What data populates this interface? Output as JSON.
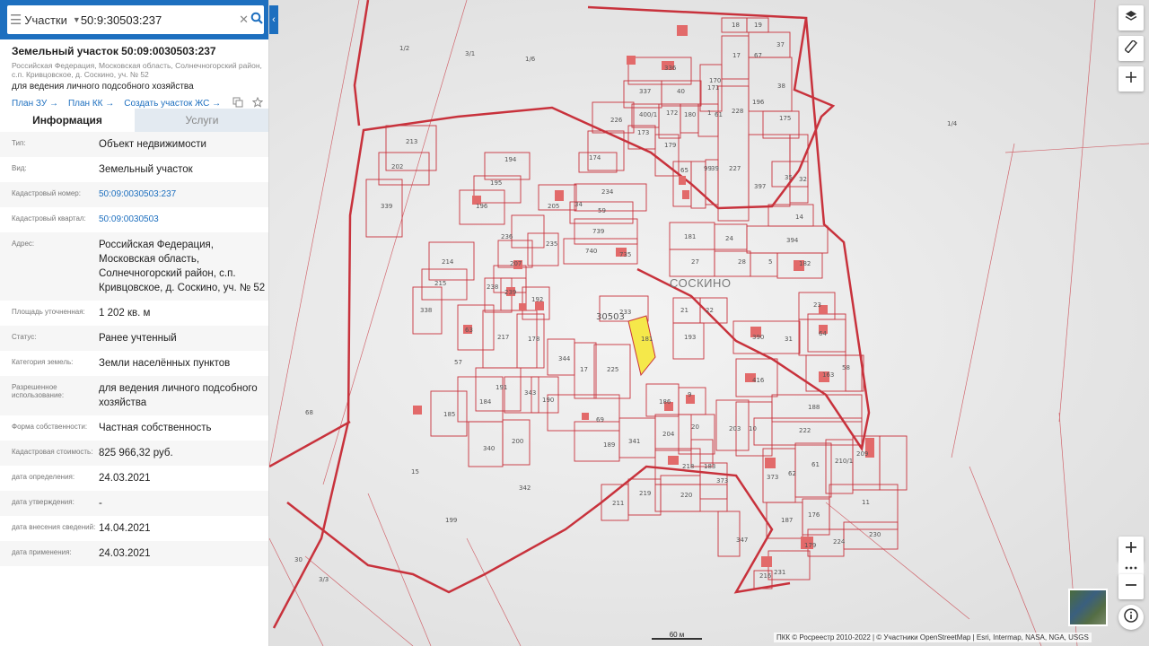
{
  "search": {
    "menu_icon": "hamburger-icon",
    "type_label": "Участки",
    "query": "50:9:30503:237",
    "clear_icon": "close-icon",
    "search_icon": "search-icon",
    "collapse_icon": "chevron-left-icon"
  },
  "object": {
    "title": "Земельный участок 50:09:0030503:237",
    "address_short": "Российская Федерация, Московская область, Солнечногорский район, с.п. Кривцовское, д. Соскино, уч. № 52",
    "purpose": "для ведения личного подсобного хозяйства",
    "links": [
      "План ЗУ →",
      "План КК →",
      "Создать участок ЖС →"
    ]
  },
  "tabs": [
    "Информация",
    "Услуги"
  ],
  "info_rows": [
    {
      "label": "Тип:",
      "value": "Объект недвижимости"
    },
    {
      "label": "Вид:",
      "value": "Земельный участок"
    },
    {
      "label": "Кадастровый номер:",
      "value": "50:09:0030503:237"
    },
    {
      "label": "Кадастровый квартал:",
      "value": "50:09:0030503"
    },
    {
      "label": "Адрес:",
      "value": "Российская Федерация, Московская область, Солнечногорский район, с.п. Кривцовское, д. Соскино, уч. № 52"
    },
    {
      "label": "Площадь уточненная:",
      "value": "1 202 кв. м"
    },
    {
      "label": "Статус:",
      "value": "Ранее учтенный"
    },
    {
      "label": "Категория земель:",
      "value": "Земли населённых пунктов"
    },
    {
      "label": "Разрешенное использование:",
      "value": "для ведения личного подсобного хозяйства"
    },
    {
      "label": "Форма собственности:",
      "value": "Частная собственность"
    },
    {
      "label": "Кадастровая стоимость:",
      "value": "825 966,32 руб."
    },
    {
      "label": "дата определения:",
      "value": "24.03.2021"
    },
    {
      "label": "дата утверждения:",
      "value": "-"
    },
    {
      "label": "дата внесения сведений:",
      "value": "14.04.2021"
    },
    {
      "label": "дата применения:",
      "value": "24.03.2021"
    }
  ],
  "map": {
    "village_label": "СОСКИНО",
    "quarter_label": "30503",
    "scale_label": "60 м",
    "attribution": "ПКК © Росреестр 2010-2022 | © Участники OpenStreetMap | Esri, Intermap, NASA, NGA, USGS",
    "parcel_labels": [
      "1/2",
      "1/6",
      "1/4",
      "3/1",
      "3/3",
      "30",
      "18",
      "19",
      "37",
      "17",
      "67",
      "38",
      "336",
      "337",
      "40",
      "171",
      "170",
      "228",
      "196",
      "226",
      "400/1",
      "172",
      "180",
      "1",
      "61",
      "175",
      "173",
      "174",
      "179",
      "65",
      "99",
      "39",
      "227",
      "397",
      "35",
      "32",
      "213",
      "202",
      "339",
      "194",
      "195",
      "196",
      "205",
      "234",
      "34",
      "59",
      "14",
      "739",
      "740",
      "735",
      "181",
      "24",
      "394",
      "27",
      "28",
      "5",
      "182",
      "214",
      "215",
      "338",
      "236",
      "235",
      "207",
      "238",
      "239",
      "192",
      "233",
      "21",
      "22",
      "23",
      "64",
      "63",
      "217",
      "178",
      "193",
      "390",
      "31",
      "57",
      "344",
      "17",
      "225",
      "416",
      "163",
      "58",
      "191",
      "343",
      "190",
      "185",
      "184",
      "69",
      "186",
      "9",
      "188",
      "68",
      "340",
      "200",
      "189",
      "341",
      "204",
      "20",
      "203",
      "10",
      "222",
      "15",
      "342",
      "218",
      "183",
      "373",
      "373",
      "62",
      "61",
      "210/1",
      "209",
      "211",
      "219",
      "220",
      "187",
      "176",
      "11",
      "199",
      "347",
      "179",
      "224",
      "230",
      "231",
      "216",
      "181",
      "237"
    ],
    "highlighted_parcel": "237"
  },
  "controls": {
    "layers_icon": "layers-icon",
    "ruler_icon": "ruler-icon",
    "crosshair_icon": "crosshair-icon",
    "zoom_in_icon": "zoom-in-icon",
    "more_icon": "more-dots-icon",
    "zoom_out_icon": "zoom-out-icon",
    "info_icon": "info-icon"
  },
  "colors": {
    "brand": "#1d6fbf",
    "parcel_border": "#c8323c",
    "highlight_fill": "#f5e84a",
    "building": "#e26a6a"
  }
}
